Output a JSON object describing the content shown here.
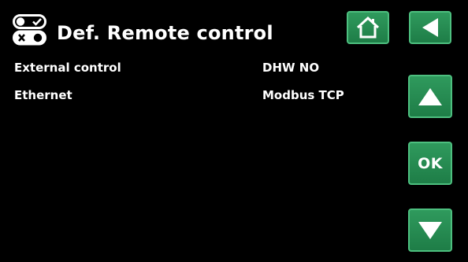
{
  "header": {
    "title": "Def. Remote control",
    "icon": "remote-control-switches-icon"
  },
  "buttons": {
    "home": {
      "icon": "home-icon"
    },
    "back": {
      "icon": "back-arrow-icon"
    },
    "up": {
      "icon": "up-arrow-icon"
    },
    "ok": {
      "label": "OK"
    },
    "down": {
      "icon": "down-arrow-icon"
    }
  },
  "settings": [
    {
      "label": "External control",
      "value": "DHW NO"
    },
    {
      "label": "Ethernet",
      "value": "Modbus TCP"
    }
  ],
  "colors": {
    "background": "#000000",
    "button": "#2a8f55",
    "button_border": "#4dbf7f",
    "text": "#ffffff"
  }
}
